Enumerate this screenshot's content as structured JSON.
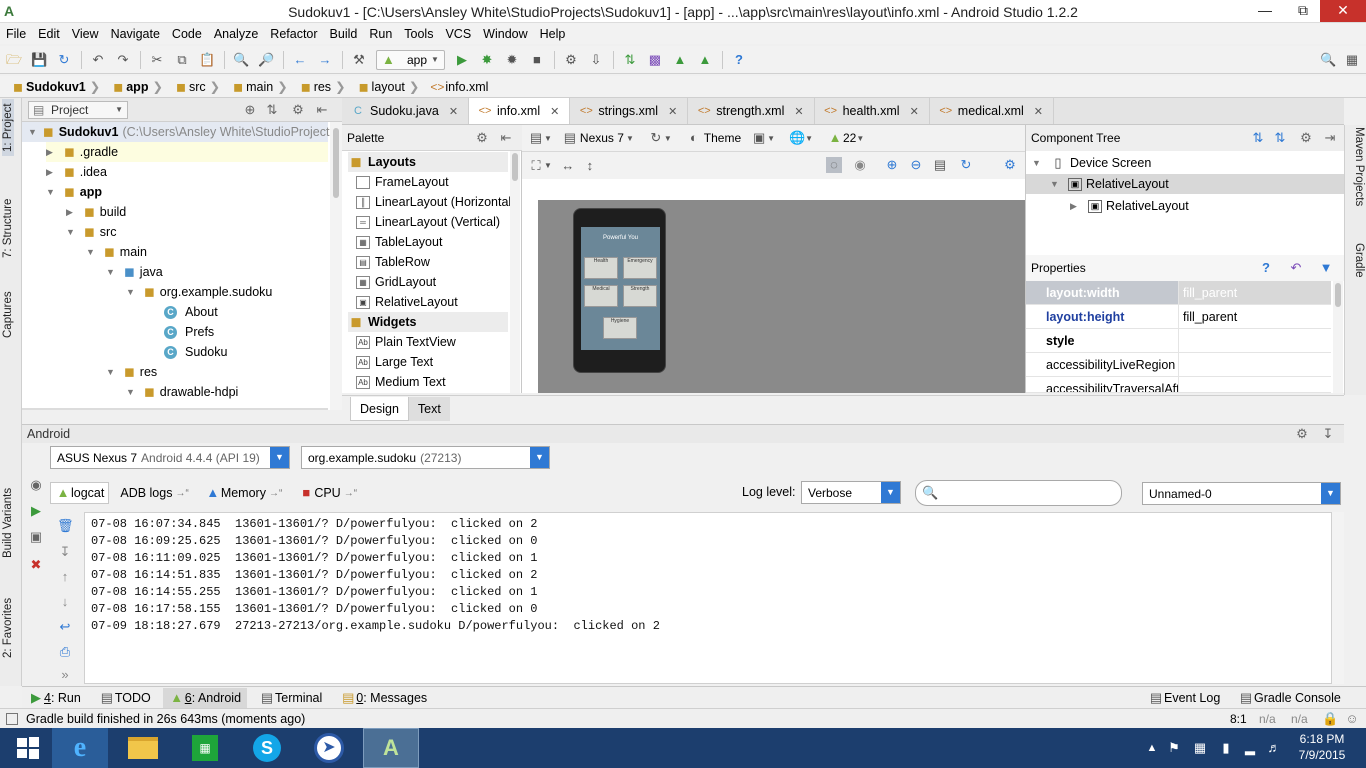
{
  "window": {
    "title": "Sudokuv1 - [C:\\Users\\Ansley White\\StudioProjects\\Sudokuv1] - [app] - ...\\app\\src\\main\\res\\layout\\info.xml - Android Studio 1.2.2",
    "controls": [
      "minimize",
      "restore",
      "close"
    ]
  },
  "menu": [
    "File",
    "Edit",
    "View",
    "Navigate",
    "Code",
    "Analyze",
    "Refactor",
    "Build",
    "Run",
    "Tools",
    "VCS",
    "Window",
    "Help"
  ],
  "toolbar": {
    "run_config": "app"
  },
  "breadcrumb": [
    "Sudokuv1",
    "app",
    "src",
    "main",
    "res",
    "layout",
    "info.xml"
  ],
  "left_tool_tabs": [
    "1: Project",
    "7: Structure",
    "Captures",
    "Build Variants",
    "2: Favorites"
  ],
  "right_tool_tabs": [
    "Maven Projects",
    "Gradle"
  ],
  "project": {
    "view": "Project",
    "tree": [
      {
        "label": "Sudokuv1",
        "detail": "(C:\\Users\\Ansley White\\StudioProjects",
        "kind": "module"
      },
      {
        "label": ".gradle",
        "kind": "folder"
      },
      {
        "label": ".idea",
        "kind": "folder"
      },
      {
        "label": "app",
        "kind": "module"
      },
      {
        "label": "build",
        "kind": "folder"
      },
      {
        "label": "src",
        "kind": "folder"
      },
      {
        "label": "main",
        "kind": "folder"
      },
      {
        "label": "java",
        "kind": "folder"
      },
      {
        "label": "org.example.sudoku",
        "kind": "package"
      },
      {
        "label": "About",
        "kind": "class"
      },
      {
        "label": "Prefs",
        "kind": "class"
      },
      {
        "label": "Sudoku",
        "kind": "class"
      },
      {
        "label": "res",
        "kind": "folder"
      },
      {
        "label": "drawable-hdpi",
        "kind": "folder"
      }
    ]
  },
  "editor_tabs": [
    {
      "label": "Sudoku.java",
      "active": false
    },
    {
      "label": "info.xml",
      "active": true
    },
    {
      "label": "strings.xml",
      "active": false
    },
    {
      "label": "strength.xml",
      "active": false
    },
    {
      "label": "health.xml",
      "active": false
    },
    {
      "label": "medical.xml",
      "active": false
    }
  ],
  "palette": {
    "title": "Palette",
    "groups": [
      {
        "name": "Layouts",
        "items": [
          "FrameLayout",
          "LinearLayout (Horizontal)",
          "LinearLayout (Vertical)",
          "TableLayout",
          "TableRow",
          "GridLayout",
          "RelativeLayout"
        ]
      },
      {
        "name": "Widgets",
        "items": [
          "Plain TextView",
          "Large Text",
          "Medium Text"
        ]
      }
    ]
  },
  "designer": {
    "device": "Nexus 7",
    "theme": "Theme",
    "api": "22",
    "preview": {
      "heading": "Powerful You",
      "tiles": [
        "Health",
        "Emergency",
        "Medical",
        "Strength",
        "Hygiene"
      ]
    },
    "mode_tabs": [
      "Design",
      "Text"
    ]
  },
  "component_tree": {
    "title": "Component Tree",
    "nodes": [
      "Device Screen",
      "RelativeLayout",
      "RelativeLayout"
    ]
  },
  "properties": {
    "title": "Properties",
    "rows": [
      {
        "name": "layout:width",
        "value": "fill_parent"
      },
      {
        "name": "layout:height",
        "value": "fill_parent"
      },
      {
        "name": "style",
        "value": ""
      },
      {
        "name": "accessibilityLiveRegion",
        "value": ""
      },
      {
        "name": "accessibilityTraversalAfte",
        "value": ""
      }
    ]
  },
  "android": {
    "title": "Android",
    "device": "ASUS Nexus 7",
    "device_detail": "Android 4.4.4 (API 19)",
    "process": "org.example.sudoku",
    "process_pid": "(27213)",
    "tabs": [
      "logcat",
      "ADB logs",
      "Memory",
      "CPU"
    ],
    "log_level_label": "Log level:",
    "log_level": "Verbose",
    "search_value": "",
    "filter": "Unnamed-0",
    "log_lines": [
      "07-08 16:07:34.845  13601-13601/? D/powerfulyou:  clicked on 2",
      "07-08 16:09:25.625  13601-13601/? D/powerfulyou:  clicked on 0",
      "07-08 16:11:09.025  13601-13601/? D/powerfulyou:  clicked on 1",
      "07-08 16:14:51.835  13601-13601/? D/powerfulyou:  clicked on 2",
      "07-08 16:14:55.255  13601-13601/? D/powerfulyou:  clicked on 1",
      "07-08 16:17:58.155  13601-13601/? D/powerfulyou:  clicked on 0",
      "07-09 18:18:27.679  27213-27213/org.example.sudoku D/powerfulyou:  clicked on 2"
    ]
  },
  "bottom_tabs": {
    "left": [
      {
        "key": "4",
        "label": ": Run"
      },
      {
        "key": "",
        "label": "TODO"
      },
      {
        "key": "6",
        "label": ": Android"
      },
      {
        "key": "",
        "label": "Terminal"
      },
      {
        "key": "0",
        "label": ": Messages"
      }
    ],
    "right": [
      "Event Log",
      "Gradle Console"
    ]
  },
  "status": {
    "message": "Gradle build finished in 26s 643ms (moments ago)",
    "position": "8:1",
    "enc1": "n/a",
    "enc2": "n/a"
  },
  "taskbar": {
    "apps": [
      "Internet Explorer",
      "File Explorer",
      "Store",
      "Skype",
      "Steam",
      "Android Studio"
    ],
    "time": "6:18 PM",
    "date": "7/9/2015"
  },
  "colors": {
    "accent_blue": "#2f79d4",
    "title_close": "#c7312b",
    "taskbar": "#1c3e6e",
    "run_green": "#3c9a3c"
  }
}
